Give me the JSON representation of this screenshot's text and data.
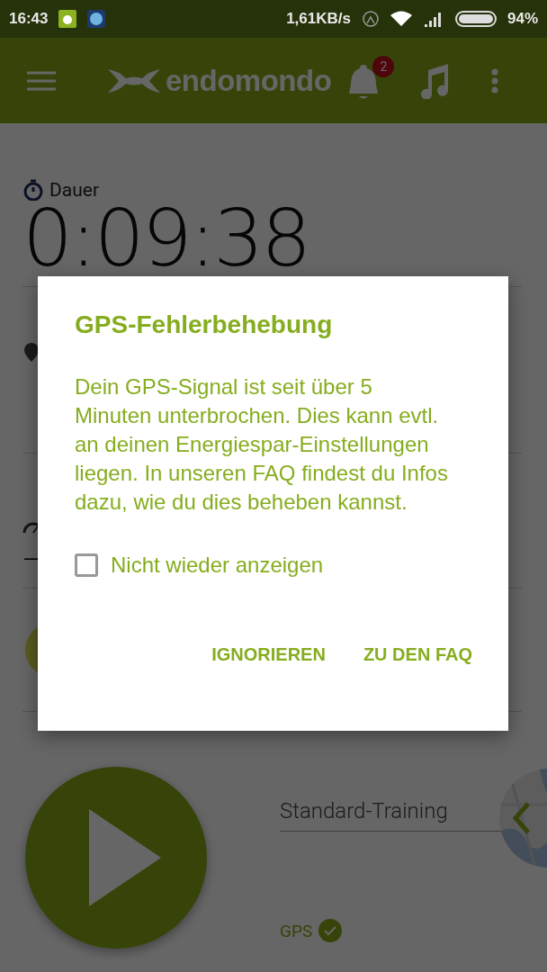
{
  "status_bar": {
    "time": "16:43",
    "net_speed": "1,61KB/s",
    "battery": "94%"
  },
  "app_bar": {
    "brand": "endomondo",
    "notification_count": "2"
  },
  "metrics": [
    {
      "kind": "duration",
      "label": "Dauer",
      "value": "0:09:38"
    },
    {
      "kind": "distance"
    },
    {
      "kind": "speed",
      "value": "–"
    },
    {
      "kind": "goal"
    }
  ],
  "workout": {
    "sport": "Standard-Training",
    "gps_label": "GPS",
    "gps_ok": true
  },
  "dialog": {
    "title": "GPS-Fehlerbehebung",
    "message": "Dein GPS-Signal ist seit über 5 Minuten unterbrochen. Dies kann evtl. an deinen Energiespar-Einstellungen liegen. In unseren FAQ findest du Infos dazu, wie du dies beheben kannst.",
    "checkbox": {
      "label": "Nicht wieder anzeigen",
      "checked": false
    },
    "buttons": [
      "IGNORIEREN",
      "ZU DEN FAQ"
    ]
  }
}
